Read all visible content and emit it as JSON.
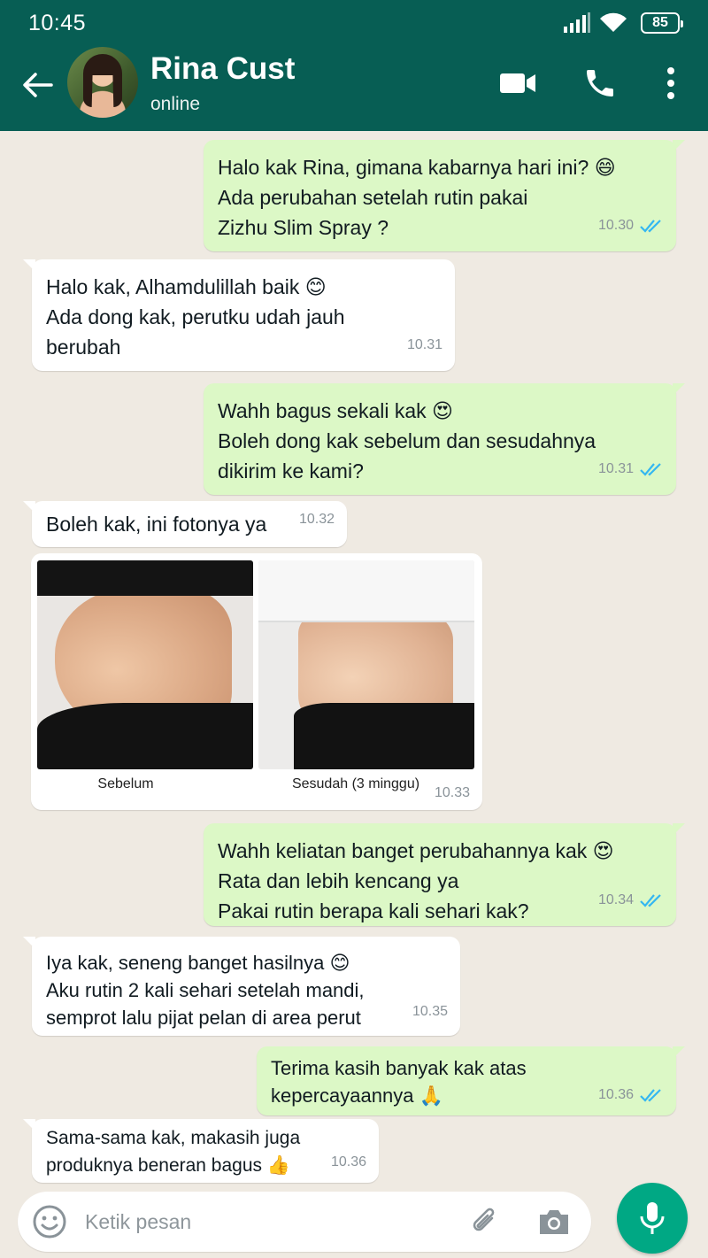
{
  "status_bar": {
    "time": "10:45",
    "battery": "85"
  },
  "header": {
    "contact_name": "Rina Cust",
    "contact_status": "online",
    "icons": [
      "back-arrow-icon",
      "video-call-icon",
      "phone-icon",
      "more-vert-icon"
    ]
  },
  "messages": [
    {
      "direction": "out",
      "text": "Halo kak Rina, gimana kabarnya hari ini? 😄\nAda perubahan setelah rutin pakai\nZizhu Slim Spray ?",
      "time": "10.30",
      "read": true
    },
    {
      "direction": "in",
      "text": "Halo kak, Alhamdulillah baik 😊\nAda dong kak, perutku udah jauh\nberubah",
      "time": "10.31"
    },
    {
      "direction": "out",
      "text": "Wahh bagus sekali kak 😍\nBoleh dong kak sebelum dan sesudahnya\ndikirim ke kami?",
      "time": "10.31",
      "read": true
    },
    {
      "direction": "in",
      "text": "Boleh kak, ini fotonya ya",
      "time": "10.32"
    },
    {
      "direction": "out",
      "text": "Wahh keliatan banget perubahannya kak 😍\nRata dan lebih kencang ya\nPakai rutin berapa kali sehari kak?",
      "time": "10.34",
      "read": true
    },
    {
      "direction": "in",
      "text": "Iya kak, seneng banget hasilnya 😊\nAku rutin 2 kali sehari setelah mandi,\nsemprot lalu pijat pelan di area perut",
      "time": "10.35"
    },
    {
      "direction": "out",
      "text": "Terima kasih banyak kak atas\nkepercayaannya 🙏",
      "time": "10.36",
      "read": true
    },
    {
      "direction": "in",
      "text": "Sama-sama kak, makasih juga\nproduknya beneran bagus 👍",
      "time": "10.36"
    }
  ],
  "photo_message": {
    "direction": "in",
    "captions": [
      "Sebelum",
      "Sesudah (3 minggu)"
    ],
    "time": "10.33"
  },
  "input_bar": {
    "placeholder": "Ketik pesan",
    "icons": [
      "emoji-icon",
      "attach-icon",
      "camera-icon",
      "mic-icon"
    ]
  },
  "colors": {
    "header": "#075e54",
    "chat_background": "#efeae2",
    "outgoing_bubble": "#dcf8c6",
    "incoming_bubble": "#ffffff",
    "read_ticks": "#34b7f1",
    "mic_button": "#00a884"
  }
}
